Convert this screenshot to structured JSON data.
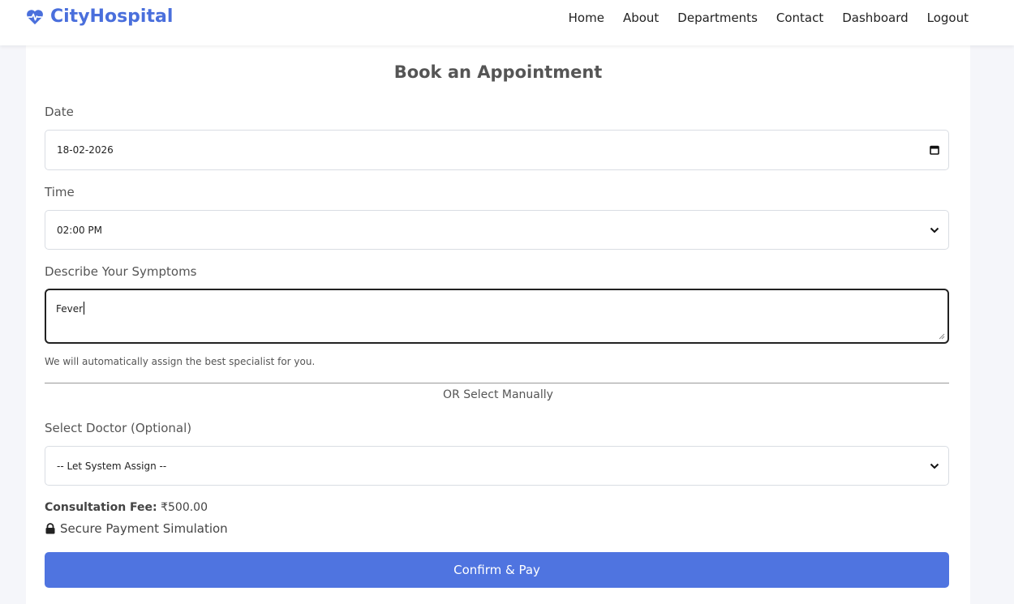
{
  "brand": {
    "name": "CityHospital",
    "color": "#4a6fdc",
    "icon": "heartbeat-icon"
  },
  "nav": [
    "Home",
    "About",
    "Departments",
    "Contact",
    "Dashboard",
    "Logout"
  ],
  "form": {
    "title": "Book an Appointment",
    "date": {
      "label": "Date",
      "value": "18-02-2026",
      "icon": "calendar-icon"
    },
    "time": {
      "label": "Time",
      "value": "02:00 PM",
      "icon": "chevron-down-icon"
    },
    "symptoms": {
      "label": "Describe Your Symptoms",
      "value": "Fever",
      "hint": "We will automatically assign the best specialist for you."
    },
    "divider_text": "OR Select Manually",
    "doctor": {
      "label": "Select Doctor (Optional)",
      "value": "-- Let System Assign --",
      "icon": "chevron-down-icon"
    },
    "fee": {
      "label": "Consultation Fee:",
      "value": "₹500.00"
    },
    "secure": {
      "label": "Secure Payment Simulation",
      "icon": "lock-icon"
    },
    "submit_label": "Confirm & Pay",
    "accent": "#4f74e0"
  }
}
